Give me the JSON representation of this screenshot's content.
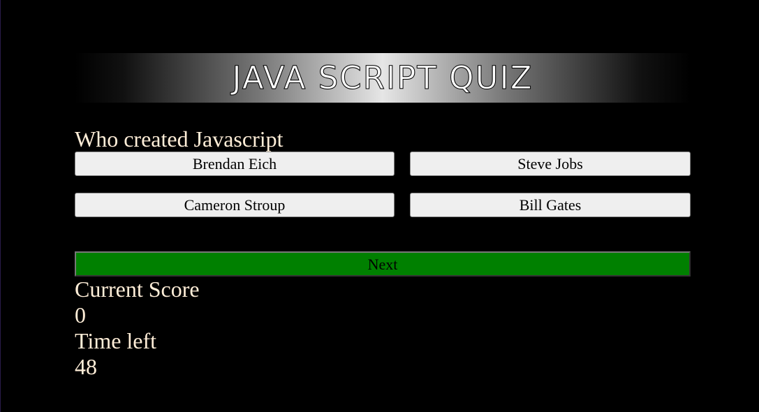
{
  "quiz": {
    "title": "JAVA SCRIPT QUIZ",
    "question": "Who created Javascript",
    "answers": [
      "Brendan Eich",
      "Steve Jobs",
      "Cameron Stroup",
      "Bill Gates"
    ],
    "next_label": "Next"
  },
  "score": {
    "label": "Current Score",
    "value": "0"
  },
  "timer": {
    "label": "Time left",
    "value": "48"
  },
  "colors": {
    "background": "#000000",
    "text": "#ffeed8",
    "next_button": "#008000",
    "answer_button": "#efefef"
  }
}
